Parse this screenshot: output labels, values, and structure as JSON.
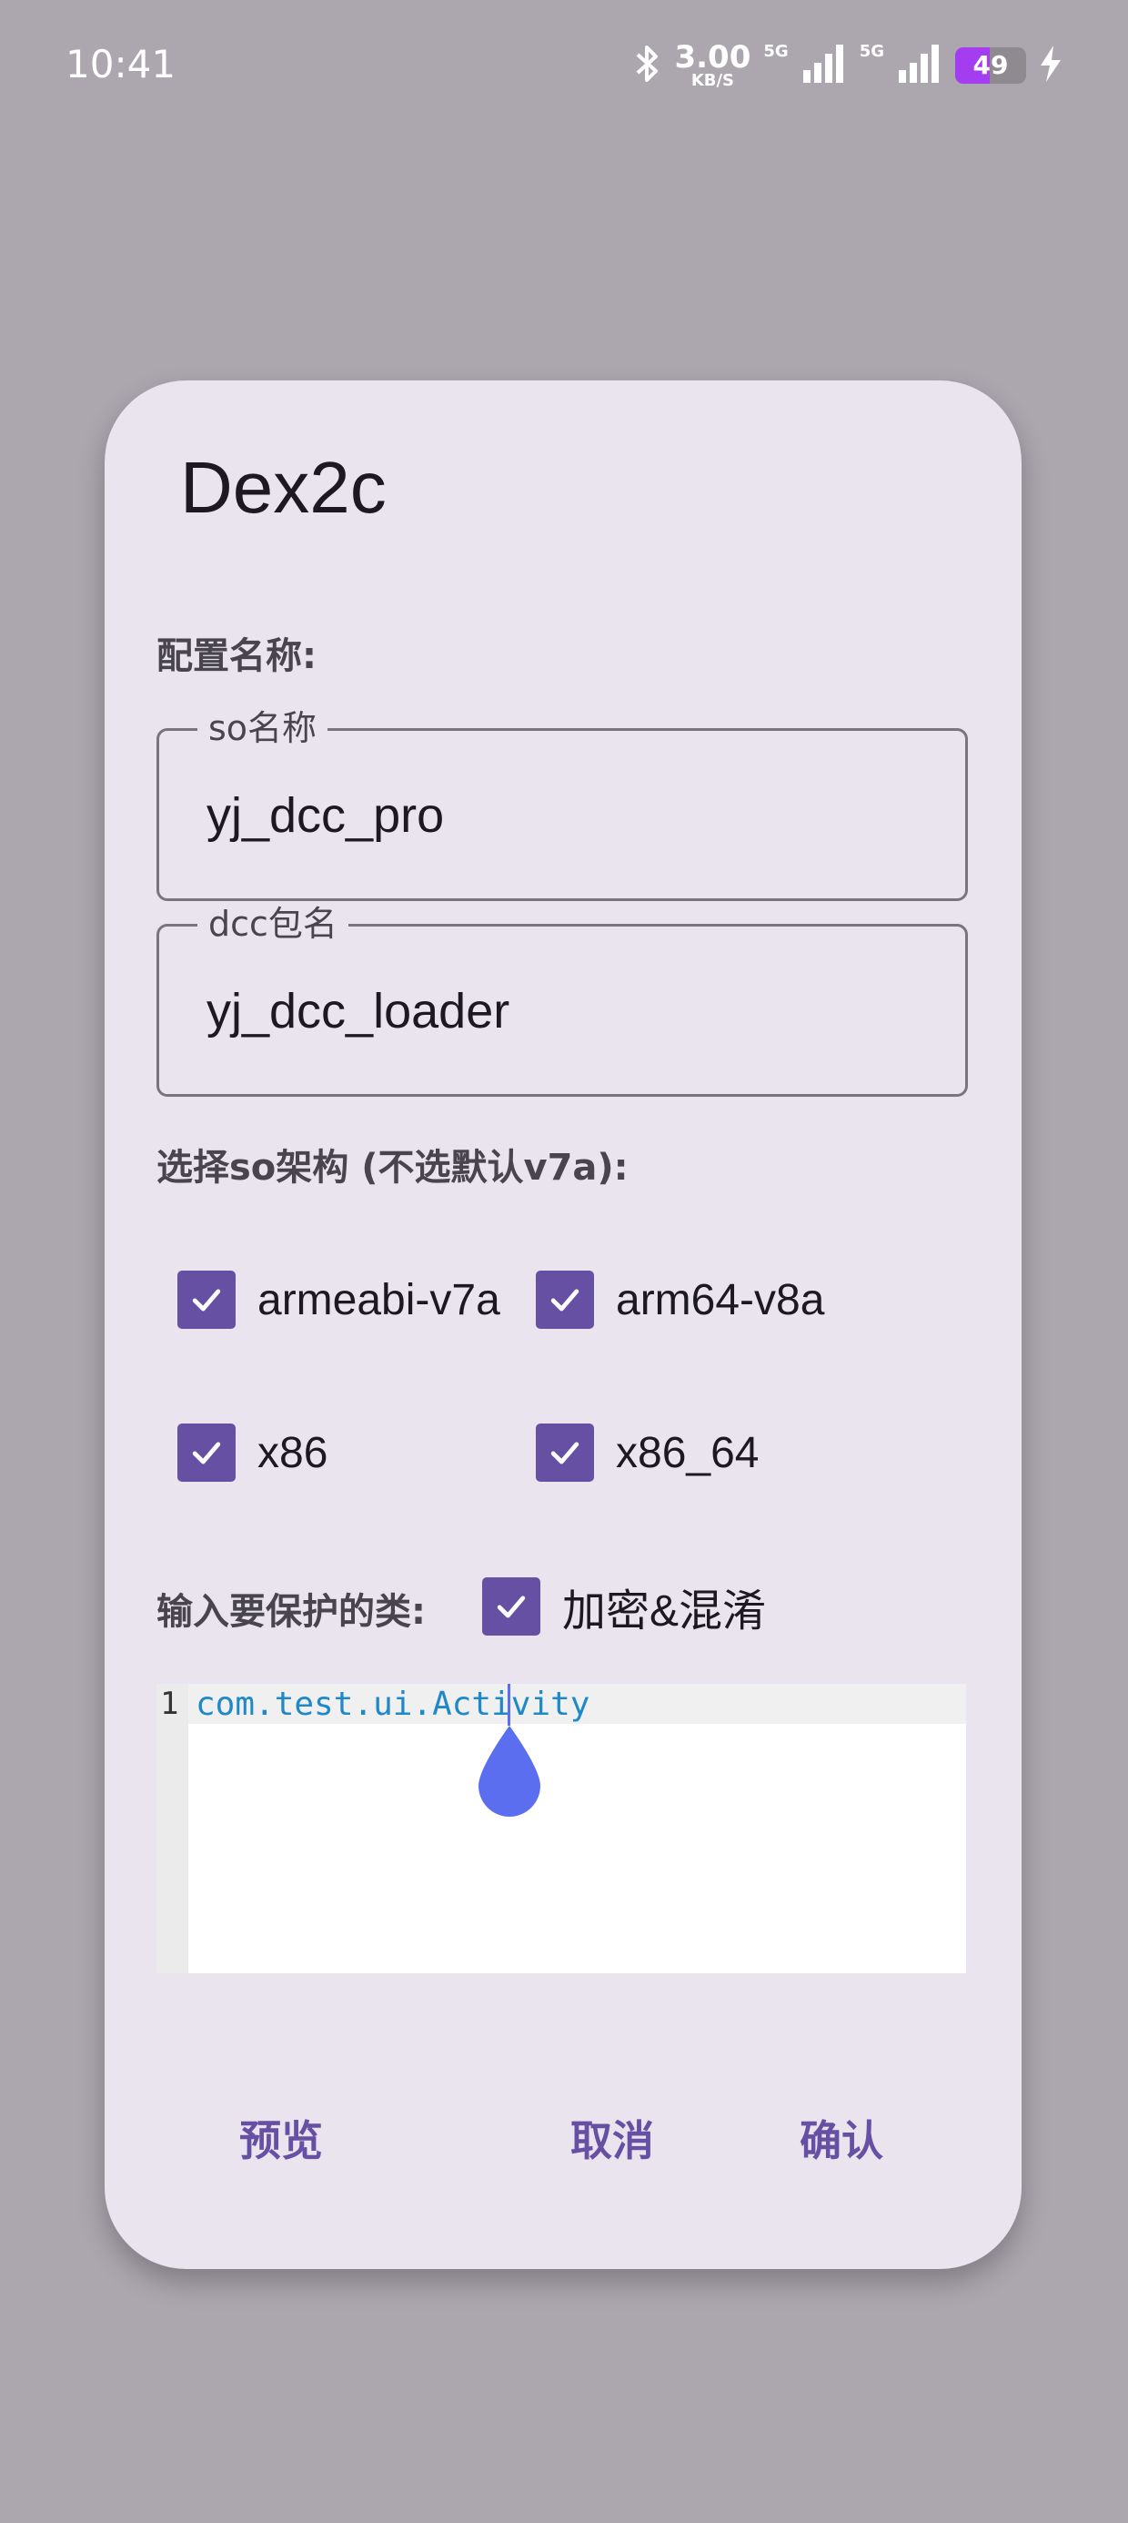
{
  "status_bar": {
    "time": "10:41",
    "speed_value": "3.00",
    "speed_unit": "KB/S",
    "network_1": "5G",
    "network_2": "5G",
    "battery_level": "49",
    "battery_fraction": 0.49,
    "battery_color": "#a43df0",
    "icons": [
      "bluetooth-icon",
      "signal-icon",
      "signal-icon",
      "battery-icon",
      "charging-icon"
    ]
  },
  "dialog": {
    "title": "Dex2c",
    "config_label": "配置名称:",
    "so_name": {
      "label": "so名称",
      "value": "yj_dcc_pro"
    },
    "dcc_package": {
      "label": "dcc包名",
      "value": "yj_dcc_loader"
    },
    "arch_label": "选择so架构 (不选默认v7a):",
    "arch_options": [
      {
        "label": "armeabi-v7a",
        "checked": true
      },
      {
        "label": "arm64-v8a",
        "checked": true
      },
      {
        "label": "x86",
        "checked": true
      },
      {
        "label": "x86_64",
        "checked": true
      }
    ],
    "protect_label": "输入要保护的类:",
    "encrypt_option": {
      "label": "加密&混淆",
      "checked": true
    },
    "editor": {
      "line_number": "1",
      "code": "com.test.ui.Activity"
    },
    "buttons": {
      "preview": "预览",
      "cancel": "取消",
      "confirm": "确认"
    }
  },
  "colors": {
    "accent": "#6650a4",
    "dialog_bg": "#eae4ef",
    "scrim": "#aca6ae",
    "code_text": "#1e88c8",
    "cursor": "#5c6ef0"
  }
}
